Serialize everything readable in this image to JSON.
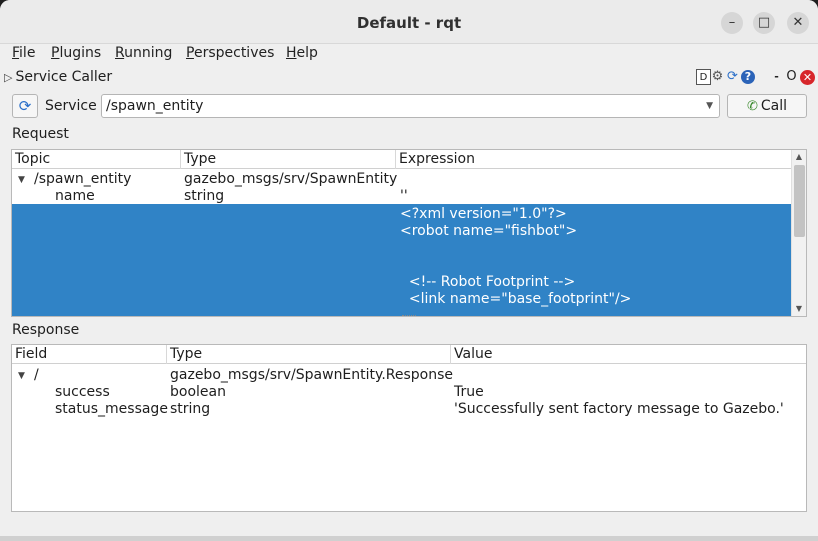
{
  "window": {
    "title": "Default - rqt",
    "minimize_glyph": "–",
    "maximize_glyph": "□",
    "close_glyph": "✕"
  },
  "menu": {
    "items": [
      {
        "first": "F",
        "rest": "ile"
      },
      {
        "first": "P",
        "rest": "lugins"
      },
      {
        "first": "R",
        "rest": "unning"
      },
      {
        "first": "P",
        "rest": "erspectives"
      },
      {
        "first": "H",
        "rest": "elp"
      }
    ]
  },
  "plugin": {
    "title": "Service Caller",
    "expand_glyph": "▷",
    "buttons": {
      "dock": "D",
      "settings": "⚙",
      "reload": "⟳",
      "help": "?",
      "minimize": "-",
      "float": "O",
      "close": "✕"
    }
  },
  "service": {
    "refresh_glyph": "⟳",
    "label": "Service",
    "value": "/spawn_entity",
    "dropdown_glyph": "▼",
    "call_glyph": "✆",
    "call_label": "Call"
  },
  "request": {
    "label": "Request",
    "columns": [
      "Topic",
      "Type",
      "Expression"
    ],
    "toggle_glyph": "▼",
    "root": {
      "topic": "/spawn_entity",
      "type": "gazebo_msgs/srv/SpawnEntity",
      "expression": ""
    },
    "name_row": {
      "topic": "name",
      "type": "string",
      "expression": "''"
    },
    "selected_lines": [
      "<?xml version=\"1.0\"?>",
      "<robot name=\"fishbot\">",
      "",
      "",
      "  <!-- Robot Footprint -->",
      "  <link name=\"base_footprint\"/>"
    ]
  },
  "response": {
    "label": "Response",
    "columns": [
      "Field",
      "Type",
      "Value"
    ],
    "toggle_glyph": "▼",
    "root": {
      "field": "/",
      "type": "gazebo_msgs/srv/SpawnEntity.Response",
      "value": ""
    },
    "rows": [
      {
        "field": "success",
        "type": "boolean",
        "value": "True"
      },
      {
        "field": "status_message",
        "type": "string",
        "value": "'Successfully sent factory message to Gazebo.'"
      }
    ]
  },
  "colors": {
    "selection": "#3083c6",
    "window_bg": "#efefef",
    "close_red": "#d7262b",
    "accent_blue": "#2a6fc9"
  }
}
